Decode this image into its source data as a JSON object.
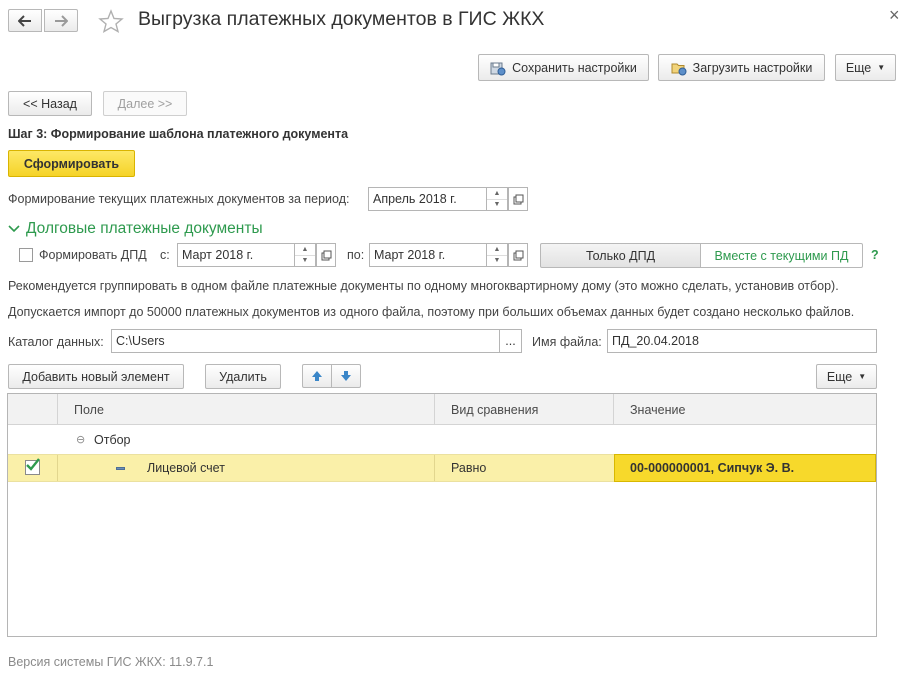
{
  "window": {
    "title": "Выгрузка платежных документов в ГИС ЖКХ",
    "close_glyph": "×"
  },
  "toolbar": {
    "save_settings": "Сохранить настройки",
    "load_settings": "Загрузить настройки",
    "more": "Еще"
  },
  "wizard": {
    "back": "<< Назад",
    "next": "Далее >>",
    "step_title": "Шаг 3: Формирование шаблона платежного документа",
    "generate": "Сформировать"
  },
  "period": {
    "label": "Формирование текущих платежных документов за период:",
    "value": "Апрель 2018 г."
  },
  "debt_group": {
    "title": "Долговые платежные документы",
    "checkbox_label": "Формировать ДПД",
    "checked": false,
    "from_label": "с:",
    "from_value": "Март 2018 г.",
    "to_label": "по:",
    "to_value": "Март 2018 г.",
    "mode_only": "Только ДПД",
    "mode_with_current": "Вместе с текущими ПД",
    "help": "?"
  },
  "notes": {
    "recommend": "Рекомендуется группировать в одном файле платежные документы по одному многоквартирному дому (это можно сделать, установив отбор).",
    "limit": "Допускается импорт до 50000 платежных документов из одного файла, поэтому при больших объемах данных будет создано несколько файлов."
  },
  "files": {
    "catalog_label": "Каталог данных:",
    "catalog_value": "C:\\Users",
    "browse": "...",
    "filename_label": "Имя файла:",
    "filename_value": "ПД_20.04.2018"
  },
  "filter_toolbar": {
    "add": "Добавить новый элемент",
    "delete": "Удалить",
    "more": "Еще"
  },
  "filter_table": {
    "columns": [
      "Поле",
      "Вид сравнения",
      "Значение"
    ],
    "group": {
      "expander": "⊖",
      "label": "Отбор"
    },
    "rows": [
      {
        "checked": true,
        "field": "Лицевой счет",
        "comparison": "Равно",
        "value": "00-000000001, Сипчук Э. В."
      }
    ]
  },
  "footer": {
    "version": "Версия системы ГИС ЖКХ: 11.9.7.1"
  },
  "colors": {
    "accent_green": "#2e9a4e",
    "selected_row": "#faf0a9",
    "selected_cell": "#f7d92b",
    "primary_button": "#f5d328"
  }
}
